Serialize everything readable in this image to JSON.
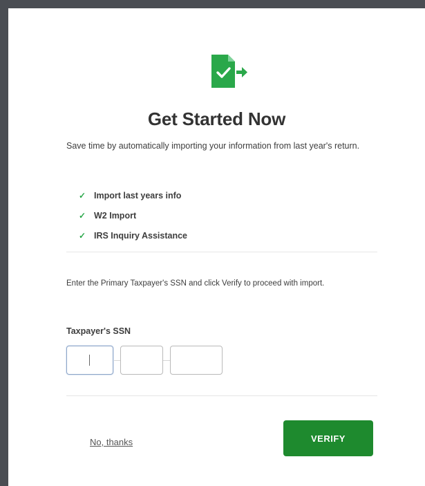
{
  "header": {
    "icon": "import-document-icon",
    "title": "Get Started Now"
  },
  "intro": {
    "text": "Save time by automatically importing your information from last year's return."
  },
  "features": [
    {
      "icon": "check-icon",
      "label": "Import last years info"
    },
    {
      "icon": "check-icon",
      "label": "W2 Import"
    },
    {
      "icon": "check-icon",
      "label": "IRS Inquiry Assistance"
    }
  ],
  "instruction": {
    "text": "Enter the Primary Taxpayer's SSN and click Verify to proceed with import."
  },
  "ssn": {
    "label": "Taxpayer's SSN",
    "part1_value": "",
    "part2_value": "",
    "part3_value": ""
  },
  "actions": {
    "no_thanks_label": "No, thanks",
    "verify_label": "VERIFY"
  },
  "colors": {
    "brand_green": "#1e8a2e",
    "icon_green": "#2aa84a",
    "backdrop": "#4a4d53"
  }
}
